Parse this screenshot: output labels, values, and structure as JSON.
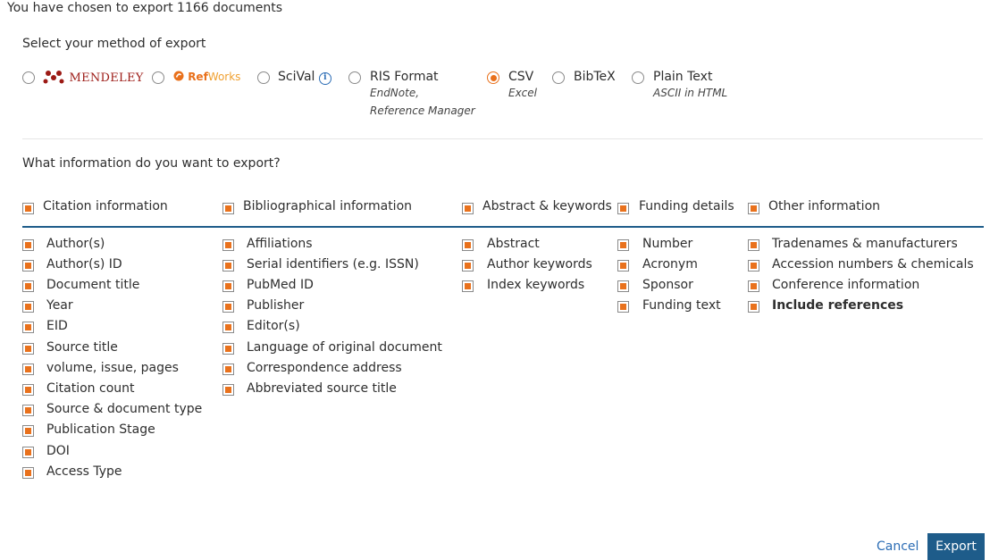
{
  "header": {
    "title": "You have chosen to export 1166 documents"
  },
  "export_method": {
    "title": "Select your method of export",
    "options": [
      {
        "label": "MENDELEY",
        "sub": "",
        "selected": false,
        "icon": "mendeley-logo-icon"
      },
      {
        "label_ref": "Ref",
        "label_works": "Works",
        "sub": "",
        "selected": false,
        "icon": "refworks-logo-icon"
      },
      {
        "label": "SciVal",
        "sub": "",
        "selected": false,
        "icon": "info-icon",
        "info_glyph": "i"
      },
      {
        "label": "RIS Format",
        "sub1": "EndNote,",
        "sub2": "Reference Manager",
        "selected": false
      },
      {
        "label": "CSV",
        "sub1": "Excel",
        "selected": true
      },
      {
        "label": "BibTeX",
        "selected": false
      },
      {
        "label": "Plain Text",
        "sub1": "ASCII in HTML",
        "selected": false
      }
    ]
  },
  "information": {
    "title": "What information do you want to export?",
    "groups": [
      {
        "label": "Citation information",
        "items": [
          "Author(s)",
          "Author(s) ID",
          "Document title",
          "Year",
          "EID",
          "Source title",
          "volume, issue, pages",
          "Citation count",
          "Source & document type",
          "Publication Stage",
          "DOI",
          "Access Type"
        ]
      },
      {
        "label": "Bibliographical information",
        "items": [
          "Affiliations",
          "Serial identifiers (e.g. ISSN)",
          "PubMed ID",
          "Publisher",
          "Editor(s)",
          "Language of original document",
          "Correspondence address",
          "Abbreviated source title"
        ]
      },
      {
        "label": "Abstract & keywords",
        "items": [
          "Abstract",
          "Author keywords",
          "Index keywords"
        ]
      },
      {
        "label": "Funding details",
        "items": [
          "Number",
          "Acronym",
          "Sponsor",
          "Funding text"
        ]
      },
      {
        "label": "Other information",
        "items": [
          "Tradenames & manufacturers",
          "Accession numbers & chemicals",
          "Conference information",
          "Include references"
        ]
      }
    ]
  },
  "actions": {
    "cancel_label": "Cancel",
    "export_label": "Export"
  },
  "colors": {
    "accent": "#e9711c",
    "primary": "#1e5c8a",
    "link": "#2c6db5"
  }
}
